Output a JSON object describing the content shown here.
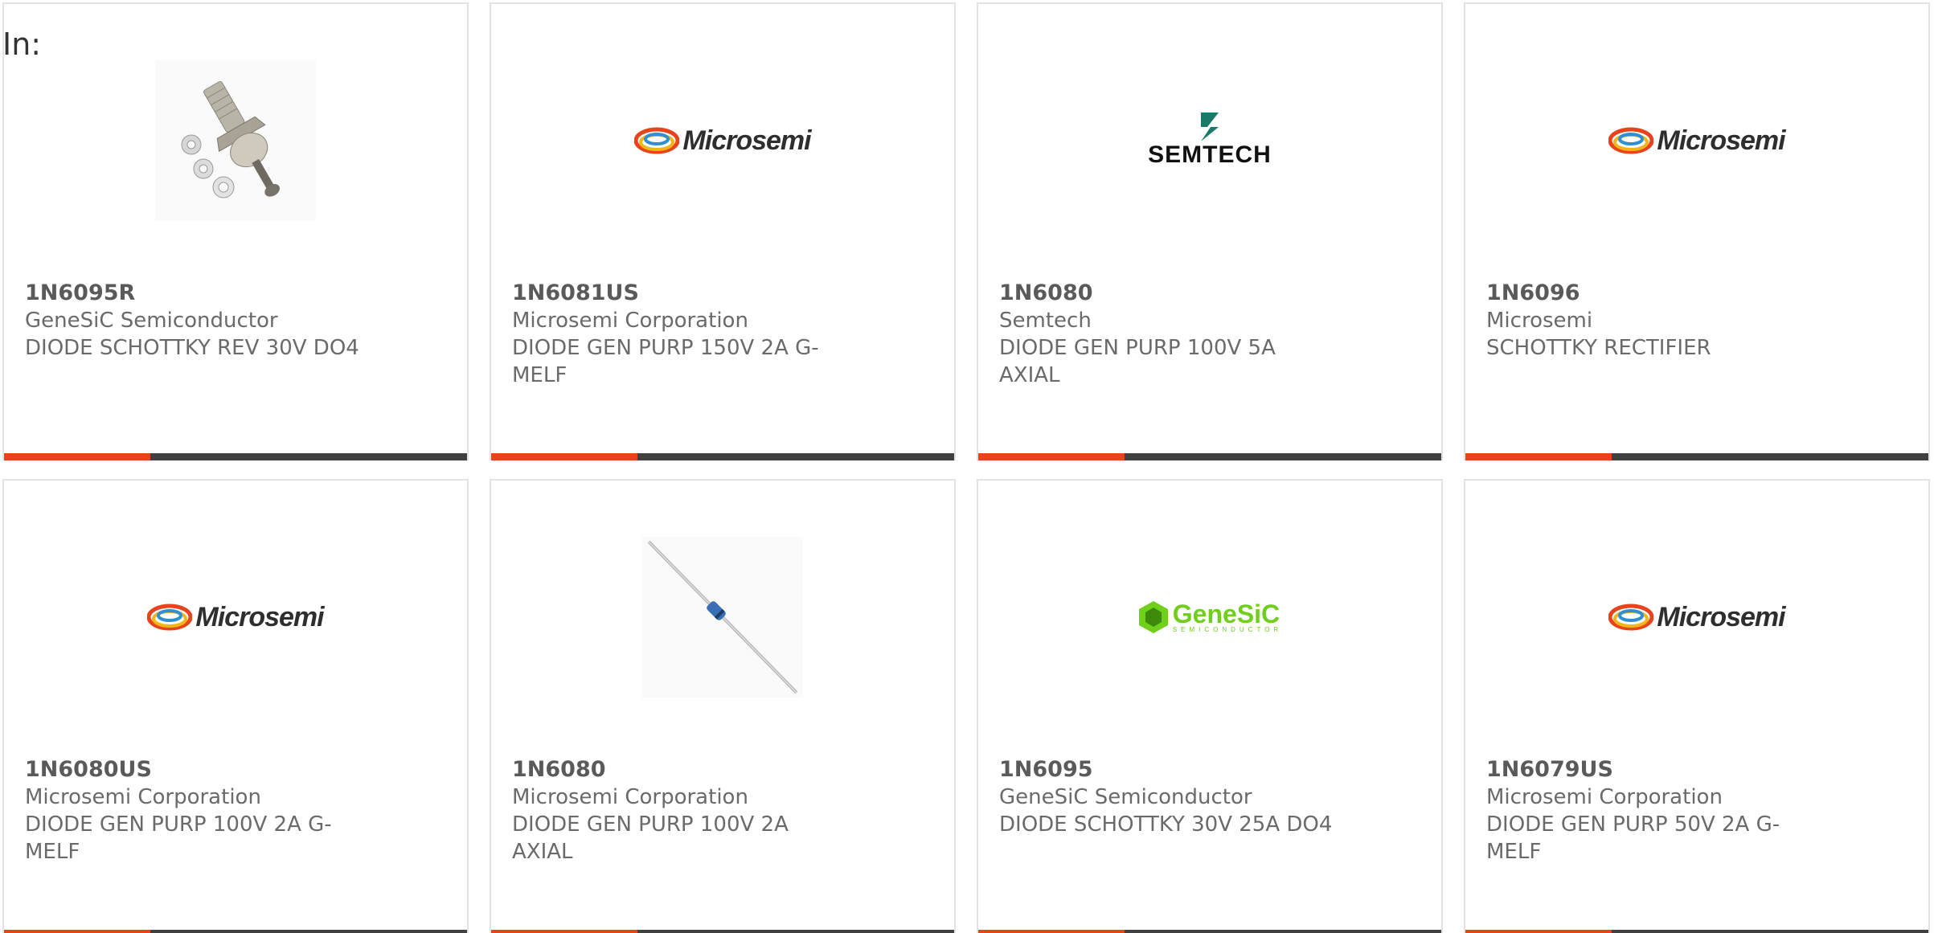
{
  "header": {
    "label": "In:"
  },
  "colors": {
    "accent": "#e8431a",
    "bar": "#404040",
    "card_border": "#e3e3e3",
    "text": "#6a6a6a"
  },
  "cards": [
    {
      "part": "1N6095R",
      "maker": "GeneSiC Semiconductor",
      "desc": "DIODE SCHOTTKY REV 30V DO4",
      "image": "stud-diode-photo"
    },
    {
      "part": "1N6081US",
      "maker": "Microsemi Corporation",
      "desc": "DIODE GEN PURP 150V 2A G-MELF",
      "image": "microsemi-logo",
      "logo_text": "Microsemi"
    },
    {
      "part": "1N6080",
      "maker": "Semtech",
      "desc": "DIODE GEN PURP 100V 5A AXIAL",
      "image": "semtech-logo",
      "logo_text": "SEMTECH"
    },
    {
      "part": "1N6096",
      "maker": "Microsemi",
      "desc": "SCHOTTKY RECTIFIER",
      "image": "microsemi-logo",
      "logo_text": "Microsemi"
    },
    {
      "part": "1N6080US",
      "maker": "Microsemi Corporation",
      "desc": "DIODE GEN PURP 100V 2A G-MELF",
      "image": "microsemi-logo",
      "logo_text": "Microsemi"
    },
    {
      "part": "1N6080",
      "maker": "Microsemi Corporation",
      "desc": "DIODE GEN PURP 100V 2A AXIAL",
      "image": "axial-diode-photo"
    },
    {
      "part": "1N6095",
      "maker": "GeneSiC Semiconductor",
      "desc": "DIODE SCHOTTKY 30V 25A DO4",
      "image": "genesic-logo",
      "logo_text": "GeneSiC",
      "logo_subtext": "SEMICONDUCTOR"
    },
    {
      "part": "1N6079US",
      "maker": "Microsemi Corporation",
      "desc": "DIODE GEN PURP 50V 2A G-MELF",
      "image": "microsemi-logo",
      "logo_text": "Microsemi"
    }
  ]
}
